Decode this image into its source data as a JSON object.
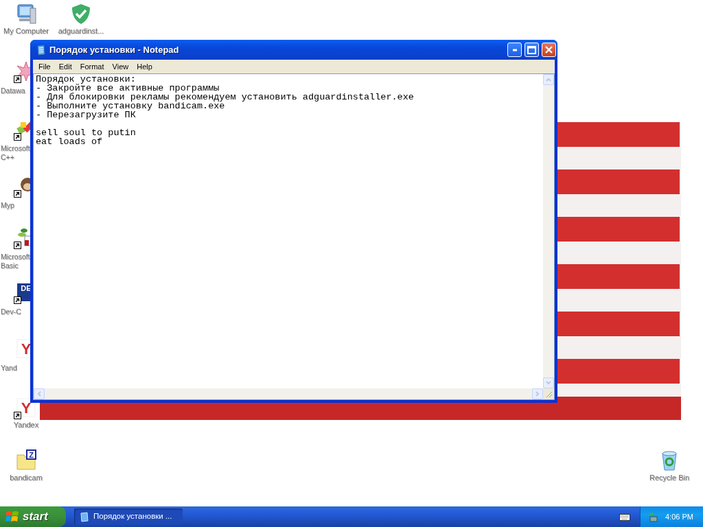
{
  "desktop_icons": [
    {
      "label": [
        "My Computer"
      ],
      "shortcut": false
    },
    {
      "label": [
        "adguardinst..."
      ],
      "shortcut": false
    },
    {
      "label": [
        "Datawa"
      ],
      "shortcut": true
    },
    {
      "label": [
        "Microsoft",
        "C++"
      ],
      "shortcut": true
    },
    {
      "label": [
        "Myp"
      ],
      "shortcut": true
    },
    {
      "label": [
        "Microsoft",
        "Basic"
      ],
      "shortcut": true
    },
    {
      "label": [
        "Dev-C"
      ],
      "shortcut": true,
      "glyph": "DE"
    },
    {
      "label": [
        "Yand"
      ],
      "shortcut": false,
      "glyph": "Y"
    },
    {
      "label": [
        "Yandex"
      ],
      "shortcut": true,
      "glyph": "Y"
    },
    {
      "label": [
        "bandicam"
      ],
      "shortcut": false,
      "glyph": "Z"
    },
    {
      "label": [
        "Recycle Bin"
      ],
      "shortcut": false
    }
  ],
  "notepad": {
    "title": "Порядок установки - Notepad",
    "menu": [
      "File",
      "Edit",
      "Format",
      "View",
      "Help"
    ],
    "paragraphs": [
      {
        "lines": [
          "Порядок установки:",
          "- Закройте все активные программы",
          "- Для блокировки рекламы рекомендуем установить adguardinstaller.exe",
          "- Выполните установку bandicam.exe",
          "- Перезагрузите ПК"
        ]
      },
      {
        "lines": [
          "sell soul to putin",
          "eat loads of"
        ]
      }
    ]
  },
  "taskbar": {
    "start": "start",
    "tasks": [
      {
        "label": "Порядок установки ...",
        "selected": true
      }
    ],
    "clock": "4:06 PM"
  }
}
